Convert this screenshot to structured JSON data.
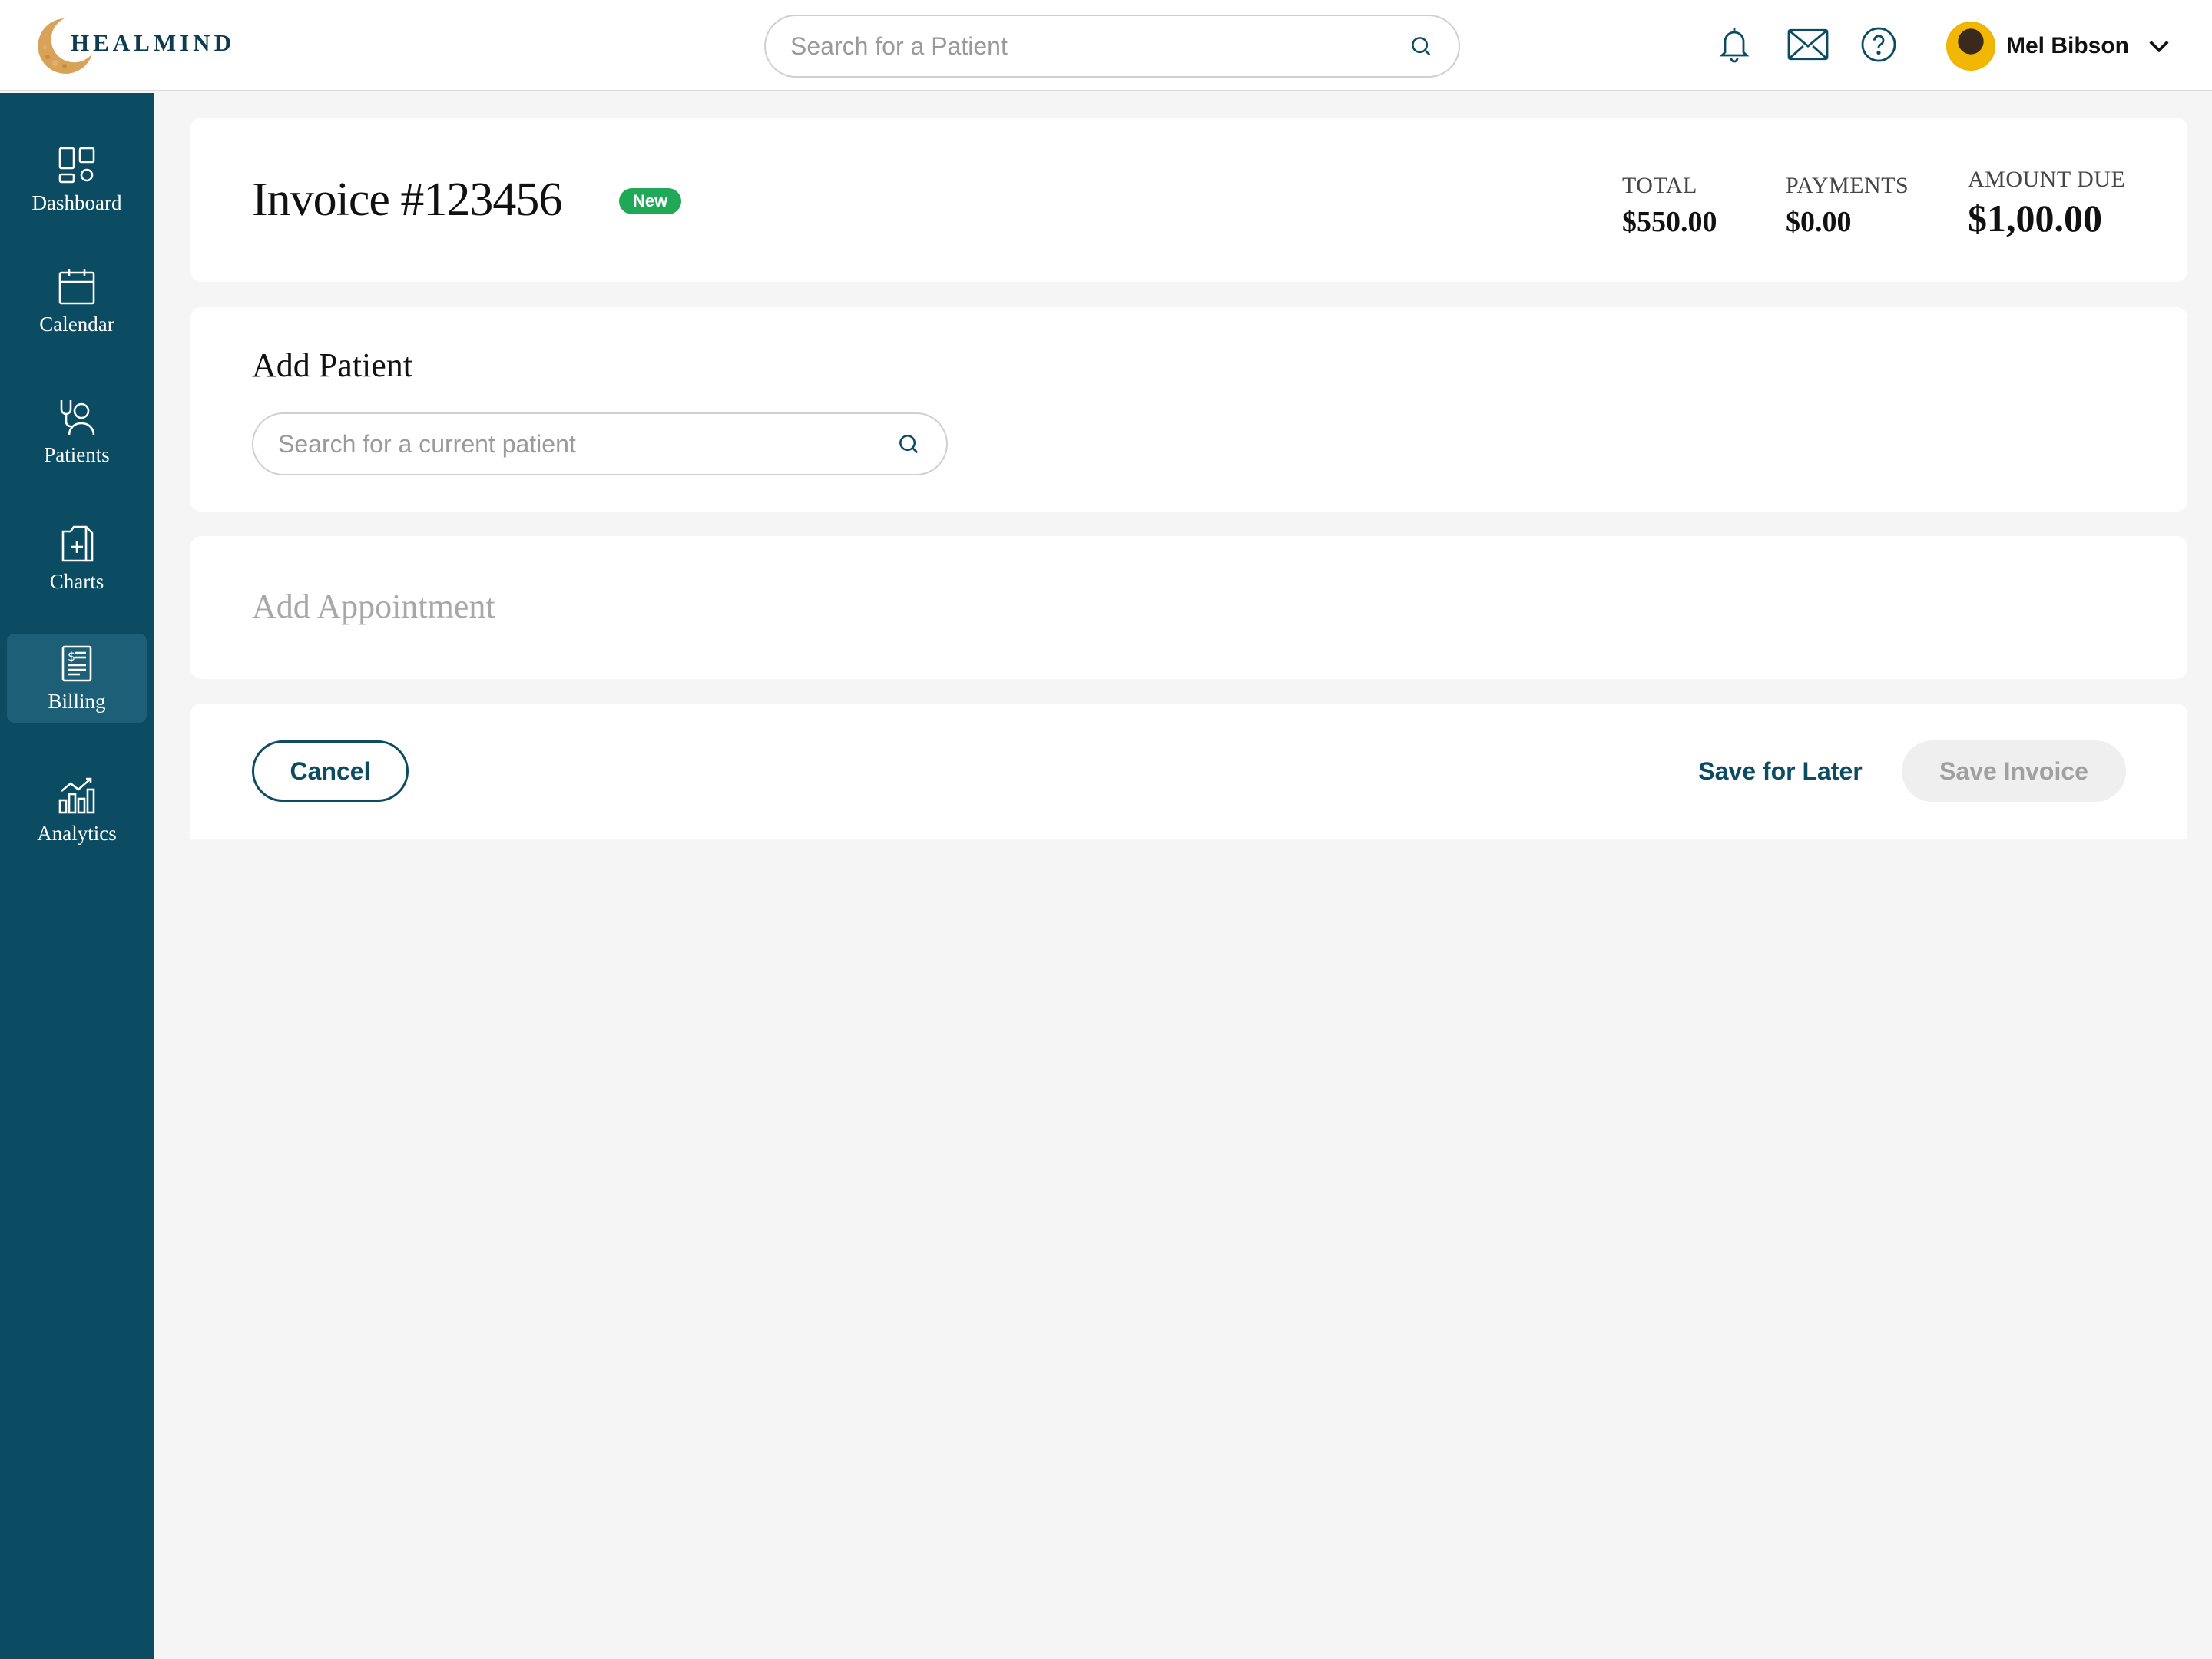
{
  "app": {
    "logo_text": "HEALMIND"
  },
  "header": {
    "search_placeholder": "Search for a Patient",
    "user_name": "Mel Bibson"
  },
  "sidebar": {
    "items": [
      {
        "label": "Dashboard",
        "icon": "dashboard-icon"
      },
      {
        "label": "Calendar",
        "icon": "calendar-icon"
      },
      {
        "label": "Patients",
        "icon": "patients-icon"
      },
      {
        "label": "Charts",
        "icon": "charts-icon"
      },
      {
        "label": "Billing",
        "icon": "billing-icon",
        "active": true
      },
      {
        "label": "Analytics",
        "icon": "analytics-icon"
      }
    ]
  },
  "invoice": {
    "title": "Invoice #123456",
    "status": "New",
    "total_label": "TOTAL",
    "total_value": "$550.00",
    "payments_label": "PAYMENTS",
    "payments_value": "$0.00",
    "due_label": "AMOUNT DUE",
    "due_value": "$1,00.00"
  },
  "add_patient": {
    "title": "Add Patient",
    "search_placeholder": "Search for a current patient"
  },
  "add_appointment": {
    "title": "Add Appointment"
  },
  "actions": {
    "cancel": "Cancel",
    "save_later": "Save for Later",
    "save_invoice": "Save Invoice"
  },
  "colors": {
    "sidebar": "#0b4c63",
    "accent": "#0b4c63",
    "badge": "#1fa855",
    "page_bg": "#f5f5f5"
  }
}
